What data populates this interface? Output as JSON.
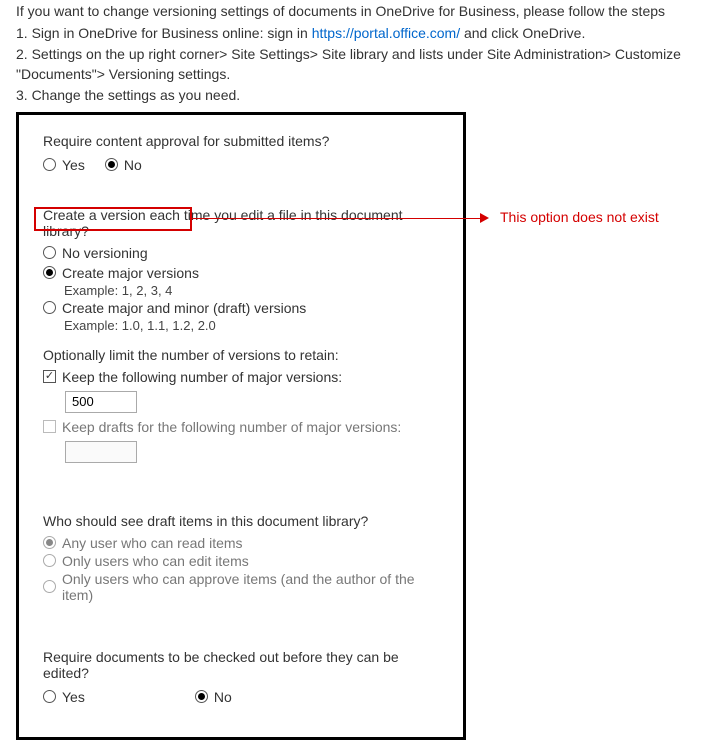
{
  "intro": {
    "line0": "If you want to change versioning settings of documents in OneDrive for Business,  please follow the steps",
    "step1_prefix": "1. Sign in OneDrive for Business online: sign in ",
    "step1_link": "https://portal.office.com/",
    "step1_suffix": " and click OneDrive.",
    "step2": "2. Settings on the up right corner> Site Settings> Site library and lists under Site Administration> Customize \"Documents\"> Versioning settings.",
    "step3": "3. Change the settings as you need."
  },
  "approval": {
    "question": "Require content approval for submitted items?",
    "yes": "Yes",
    "no": "No",
    "selected": "no"
  },
  "versioning": {
    "question": "Create a version each time you edit a file in this document library?",
    "no_versioning": "No versioning",
    "major": "Create major versions",
    "major_example": "Example: 1, 2, 3, 4",
    "minor": "Create major and minor (draft) versions",
    "minor_example": "Example: 1.0, 1.1, 1.2, 2.0",
    "selected": "major"
  },
  "limits": {
    "heading": "Optionally limit the number of versions to retain:",
    "keep_major": "Keep the following number of major versions:",
    "keep_major_value": "500",
    "keep_drafts": "Keep drafts for the following number of major versions:",
    "keep_drafts_value": ""
  },
  "drafts": {
    "question": "Who should see draft items in this document library?",
    "any": "Any user who can read items",
    "edit": "Only users who can edit items",
    "approve": "Only users who can approve items (and the author of the item)",
    "selected": "any"
  },
  "checkout": {
    "question": "Require documents to be checked out before they can be edited?",
    "yes": "Yes",
    "no": "No",
    "selected": "no"
  },
  "annotation": {
    "text": "This option does not exist"
  }
}
